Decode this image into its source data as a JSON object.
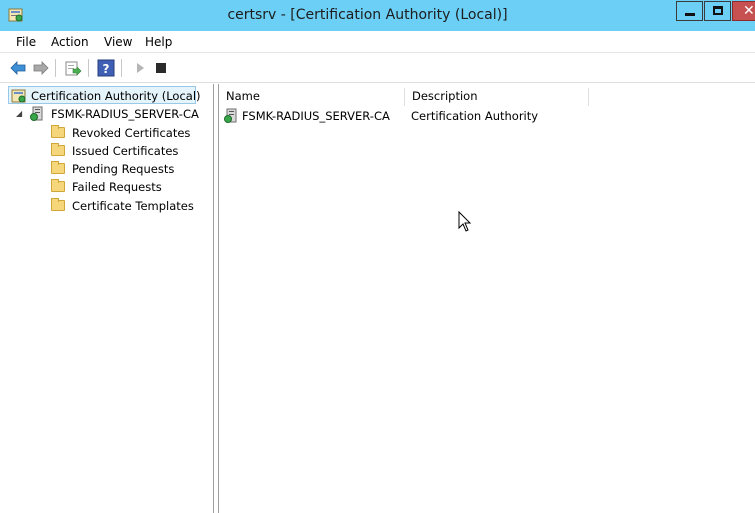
{
  "window": {
    "title": "certsrv - [Certification Authority (Local)]",
    "close_glyph": "✕",
    "colors": {
      "titlebar": "#6ccff6",
      "selection": "#e5f3fb",
      "close": "#c75050"
    }
  },
  "menu": [
    "File",
    "Action",
    "View",
    "Help"
  ],
  "toolbar": {
    "icons": [
      "back-arrow-icon",
      "forward-arrow-icon",
      "export-list-icon",
      "help-icon",
      "start-service-icon",
      "stop-service-icon"
    ]
  },
  "tree": {
    "root": "Certification Authority (Local)",
    "ca": {
      "expander": "◢",
      "name": "FSMK-RADIUS_SERVER-CA"
    },
    "folders": [
      "Revoked Certificates",
      "Issued Certificates",
      "Pending Requests",
      "Failed Requests",
      "Certificate Templates"
    ]
  },
  "list": {
    "columns": [
      "Name",
      "Description"
    ],
    "rows": [
      {
        "name": "FSMK-RADIUS_SERVER-CA",
        "description": "Certification Authority"
      }
    ]
  }
}
